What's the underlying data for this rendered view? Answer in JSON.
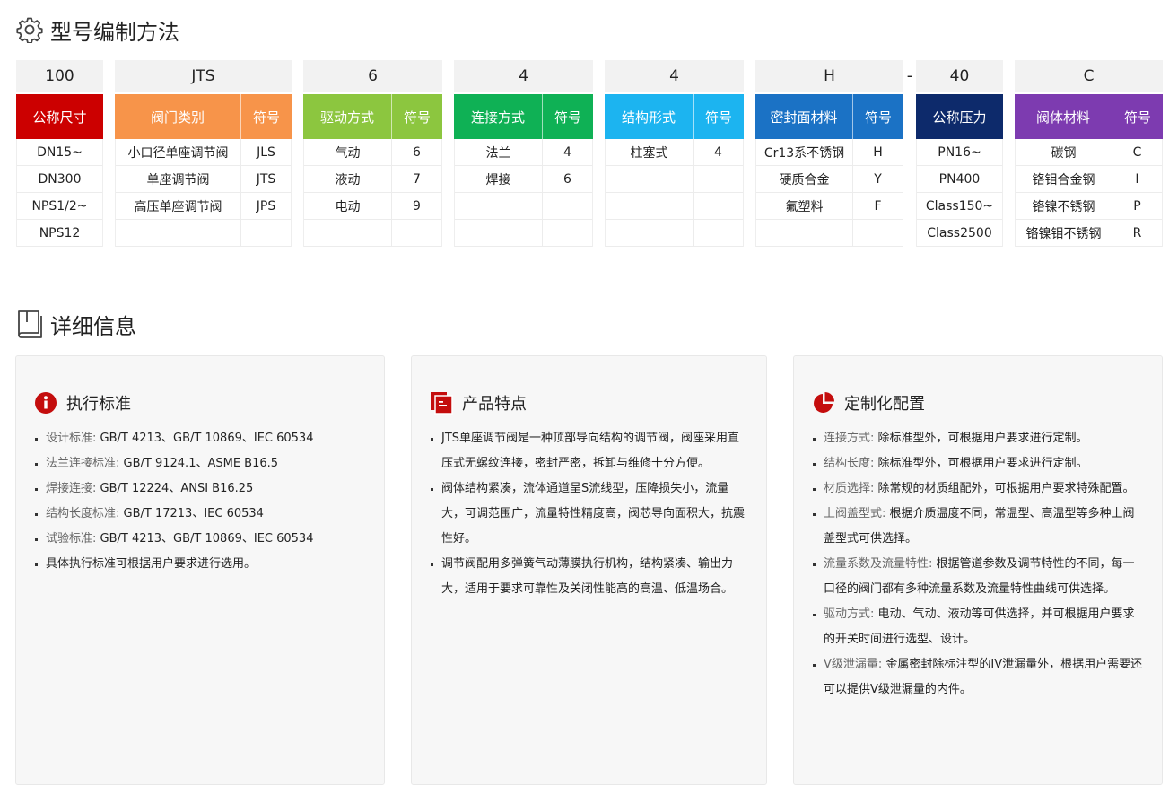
{
  "model_section": {
    "title": "型号编制方法",
    "separator": "-",
    "blocks": [
      {
        "code": "100",
        "cats": [
          {
            "label": "公称尺寸",
            "color": "#cc0000"
          }
        ],
        "rows": [
          [
            "DN15~"
          ],
          [
            "DN300"
          ],
          [
            "NPS1/2~"
          ],
          [
            "NPS12"
          ]
        ]
      },
      {
        "code": "JTS",
        "cats": [
          {
            "label": "阀门类别",
            "color": "#f7944a"
          },
          {
            "label": "符号",
            "color": "#f7944a"
          }
        ],
        "rows": [
          [
            "小口径单座调节阀",
            "JLS"
          ],
          [
            "单座调节阀",
            "JTS"
          ],
          [
            "高压单座调节阀",
            "JPS"
          ],
          [
            "",
            ""
          ]
        ]
      },
      {
        "code": "6",
        "cats": [
          {
            "label": "驱动方式",
            "color": "#8cc63f"
          },
          {
            "label": "符号",
            "color": "#8cc63f"
          }
        ],
        "rows": [
          [
            "气动",
            "6"
          ],
          [
            "液动",
            "7"
          ],
          [
            "电动",
            "9"
          ],
          [
            "",
            ""
          ]
        ]
      },
      {
        "code": "4",
        "cats": [
          {
            "label": "连接方式",
            "color": "#0fb155"
          },
          {
            "label": "符号",
            "color": "#0fb155"
          }
        ],
        "rows": [
          [
            "法兰",
            "4"
          ],
          [
            "焊接",
            "6"
          ],
          [
            "",
            ""
          ],
          [
            "",
            ""
          ]
        ]
      },
      {
        "code": "4",
        "cats": [
          {
            "label": "结构形式",
            "color": "#1cb4f0"
          },
          {
            "label": "符号",
            "color": "#1cb4f0"
          }
        ],
        "rows": [
          [
            "柱塞式",
            "4"
          ],
          [
            "",
            ""
          ],
          [
            "",
            ""
          ],
          [
            "",
            ""
          ]
        ]
      },
      {
        "code": "H",
        "cats": [
          {
            "label": "密封面材料",
            "color": "#1b72c5"
          },
          {
            "label": "符号",
            "color": "#1b72c5"
          }
        ],
        "rows": [
          [
            "Cr13系不锈钢",
            "H"
          ],
          [
            "硬质合金",
            "Y"
          ],
          [
            "氟塑料",
            "F"
          ],
          [
            "",
            ""
          ]
        ]
      },
      {
        "code": "40",
        "cats": [
          {
            "label": "公称压力",
            "color": "#0d2a6b"
          }
        ],
        "rows": [
          [
            "PN16~"
          ],
          [
            "PN400"
          ],
          [
            "Class150~"
          ],
          [
            "Class2500"
          ]
        ]
      },
      {
        "code": "C",
        "cats": [
          {
            "label": "阀体材料",
            "color": "#7d3bb0"
          },
          {
            "label": "符号",
            "color": "#7d3bb0"
          }
        ],
        "rows": [
          [
            "碳钢",
            "C"
          ],
          [
            "铬钼合金钢",
            "I"
          ],
          [
            "铬镍不锈钢",
            "P"
          ],
          [
            "铬镍钼不锈钢",
            "R"
          ]
        ]
      }
    ]
  },
  "detail_section": {
    "title": "详细信息",
    "cards": [
      {
        "title": "执行标准",
        "icon": "info-icon",
        "items": [
          {
            "label": "设计标准:",
            "text": "GB/T 4213、GB/T 10869、IEC 60534"
          },
          {
            "label": "法兰连接标准:",
            "text": "GB/T 9124.1、ASME B16.5"
          },
          {
            "label": "焊接连接:",
            "text": "GB/T 12224、ANSI B16.25"
          },
          {
            "label": "结构长度标准:",
            "text": "GB/T 17213、IEC 60534"
          },
          {
            "label": "试验标准:",
            "text": "GB/T 4213、GB/T 10869、IEC 60534"
          },
          {
            "label": "",
            "text": "具体执行标准可根据用户要求进行选用。"
          }
        ]
      },
      {
        "title": "产品特点",
        "icon": "document-icon",
        "items": [
          {
            "label": "",
            "text": "JTS单座调节阀是一种顶部导向结构的调节阀，阀座采用直压式无螺纹连接，密封严密，拆卸与维修十分方便。"
          },
          {
            "label": "",
            "text": "阀体结构紧凑，流体通道呈S流线型，压降损失小，流量大，可调范围广，流量特性精度高，阀芯导向面积大，抗震性好。"
          },
          {
            "label": "",
            "text": "调节阀配用多弹簧气动薄膜执行机构，结构紧凑、输出力大，适用于要求可靠性及关闭性能高的高温、低温场合。"
          }
        ]
      },
      {
        "title": "定制化配置",
        "icon": "pie-chart-icon",
        "items": [
          {
            "label": "连接方式:",
            "text": "除标准型外，可根据用户要求进行定制。"
          },
          {
            "label": "结构长度:",
            "text": "除标准型外，可根据用户要求进行定制。"
          },
          {
            "label": "材质选择:",
            "text": "除常规的材质组配外，可根据用户要求特殊配置。"
          },
          {
            "label": "上阀盖型式:",
            "text": "根据介质温度不同，常温型、高温型等多种上阀盖型式可供选择。"
          },
          {
            "label": "流量系数及流量特性:",
            "text": "根据管道参数及调节特性的不同，每一口径的阀门都有多种流量系数及流量特性曲线可供选择。"
          },
          {
            "label": "驱动方式:",
            "text": "电动、气动、液动等可供选择，并可根据用户要求的开关时间进行选型、设计。"
          },
          {
            "label": "V级泄漏量:",
            "text": "金属密封除标注型的IV泄漏量外，根据用户需要还可以提供V级泄漏量的内件。"
          }
        ]
      }
    ]
  }
}
